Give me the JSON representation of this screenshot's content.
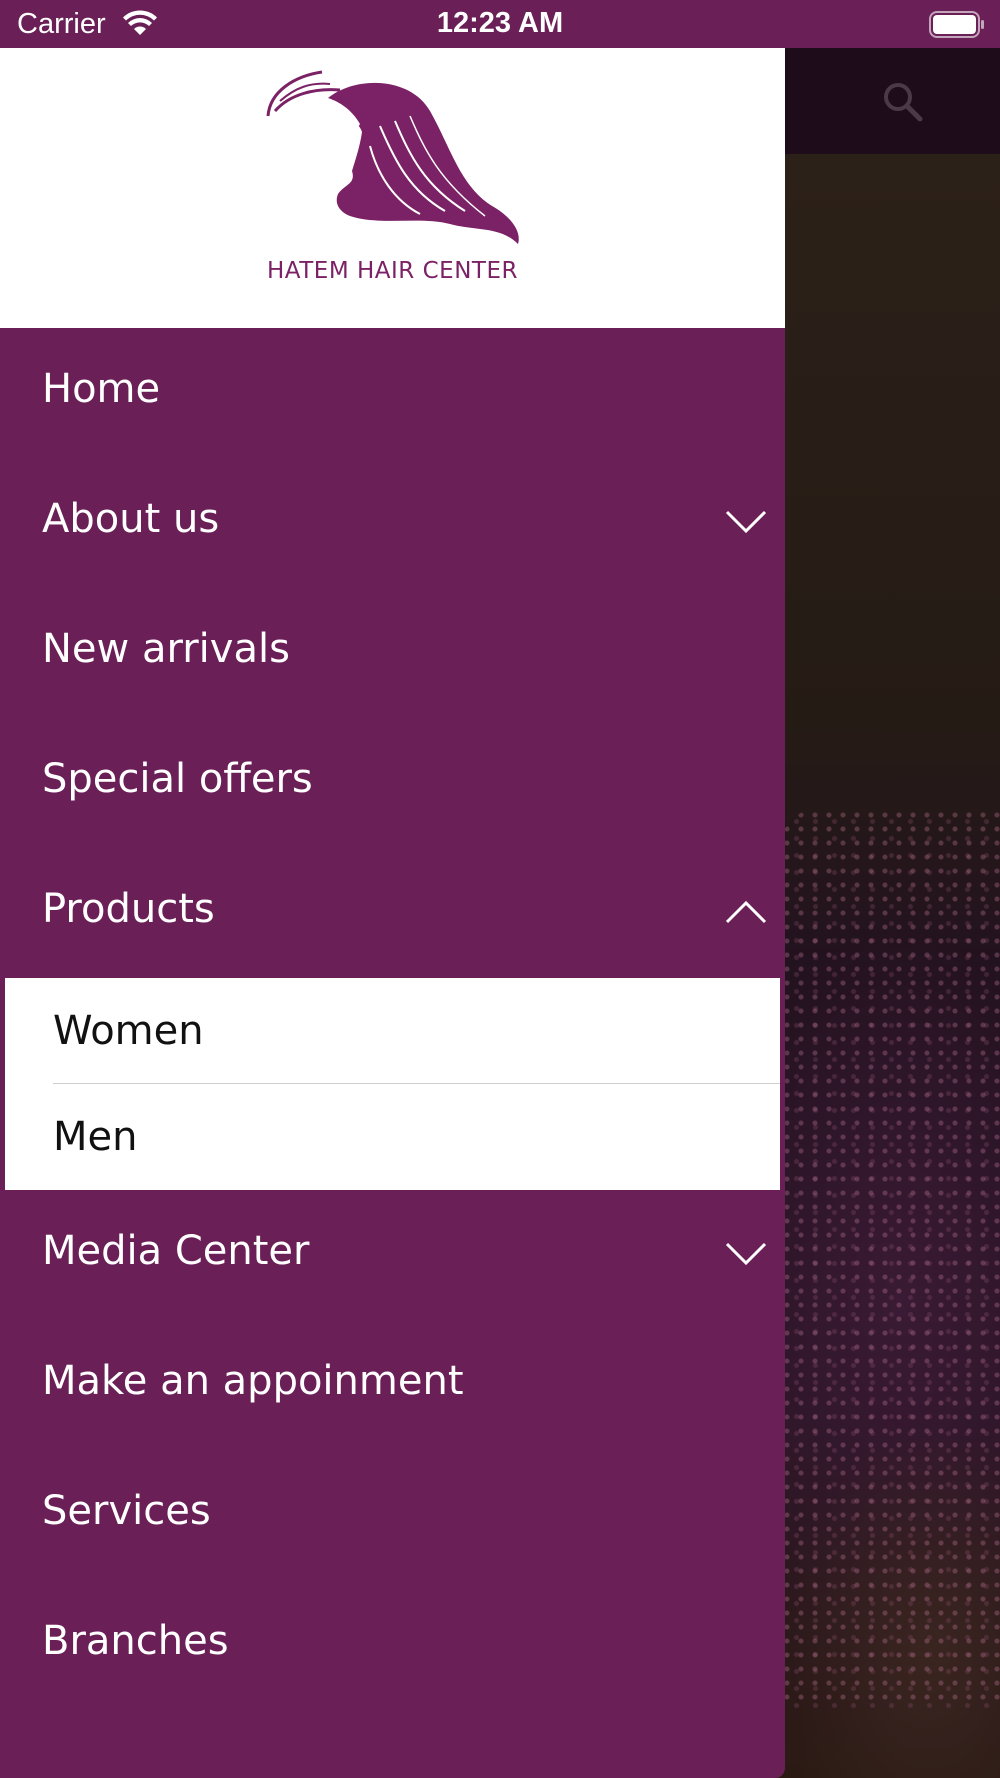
{
  "status_bar": {
    "carrier": "Carrier",
    "time": "12:23 AM",
    "icons": [
      "wifi-icon",
      "battery-icon"
    ]
  },
  "background_app": {
    "icons": [
      "search-icon"
    ]
  },
  "drawer": {
    "logo_text": "HATEM HAIR CENTER",
    "menu": [
      {
        "label": "Home"
      },
      {
        "label": "About us",
        "chevron": "down"
      },
      {
        "label": "New arrivals"
      },
      {
        "label": "Special offers"
      },
      {
        "label": "Products",
        "chevron": "up",
        "expanded": true
      },
      {
        "label": "Media Center",
        "chevron": "down"
      },
      {
        "label": "Make an appoinment"
      },
      {
        "label": "Services"
      },
      {
        "label": "Branches"
      }
    ],
    "products_submenu": [
      {
        "label": "Women"
      },
      {
        "label": "Men"
      }
    ]
  },
  "colors": {
    "brand": "#6a1f57",
    "logo": "#7b2266",
    "drawer_header": "#ffffff"
  }
}
